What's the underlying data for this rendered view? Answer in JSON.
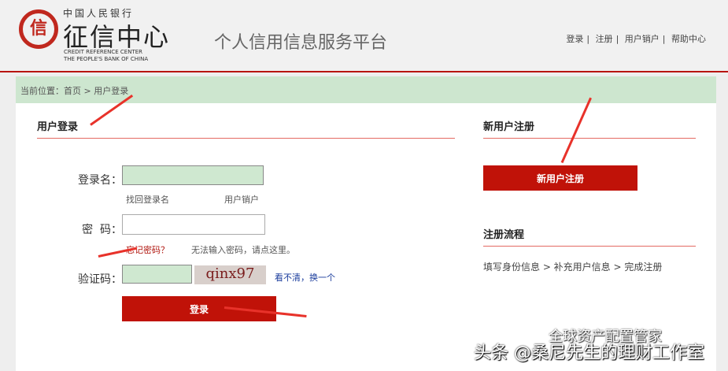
{
  "header": {
    "logo_top": "中国人民银行",
    "logo_main": "征信中心",
    "logo_en_1": "CREDIT REFERENCE CENTER",
    "logo_en_2": "THE PEOPLE'S BANK OF CHINA",
    "site_title": "个人信用信息服务平台",
    "links": [
      "登录",
      "注册",
      "用户销户",
      "帮助中心"
    ]
  },
  "breadcrumb": "当前位置：首页 > 用户登录",
  "login": {
    "title": "用户登录",
    "username_label": "登录名：",
    "username_value": "",
    "find_username": "找回登录名",
    "cancel_account": "用户销户",
    "password_label": "密  码：",
    "password_value": "",
    "forgot_password": "忘记密码？",
    "cannot_input": "无法输入密码，请点这里。",
    "captcha_label": "验证码：",
    "captcha_value": "",
    "captcha_text": "qinx97",
    "refresh_captcha": "看不清，换一个",
    "submit": "登录"
  },
  "register": {
    "title": "新用户注册",
    "button": "新用户注册",
    "flow_title": "注册流程",
    "flow": "填写身份信息 > 补充用户信息 > 完成注册"
  },
  "watermark": {
    "line1": "全球资产配置管家",
    "line2": "头条 @桑尼先生的理财工作室"
  }
}
